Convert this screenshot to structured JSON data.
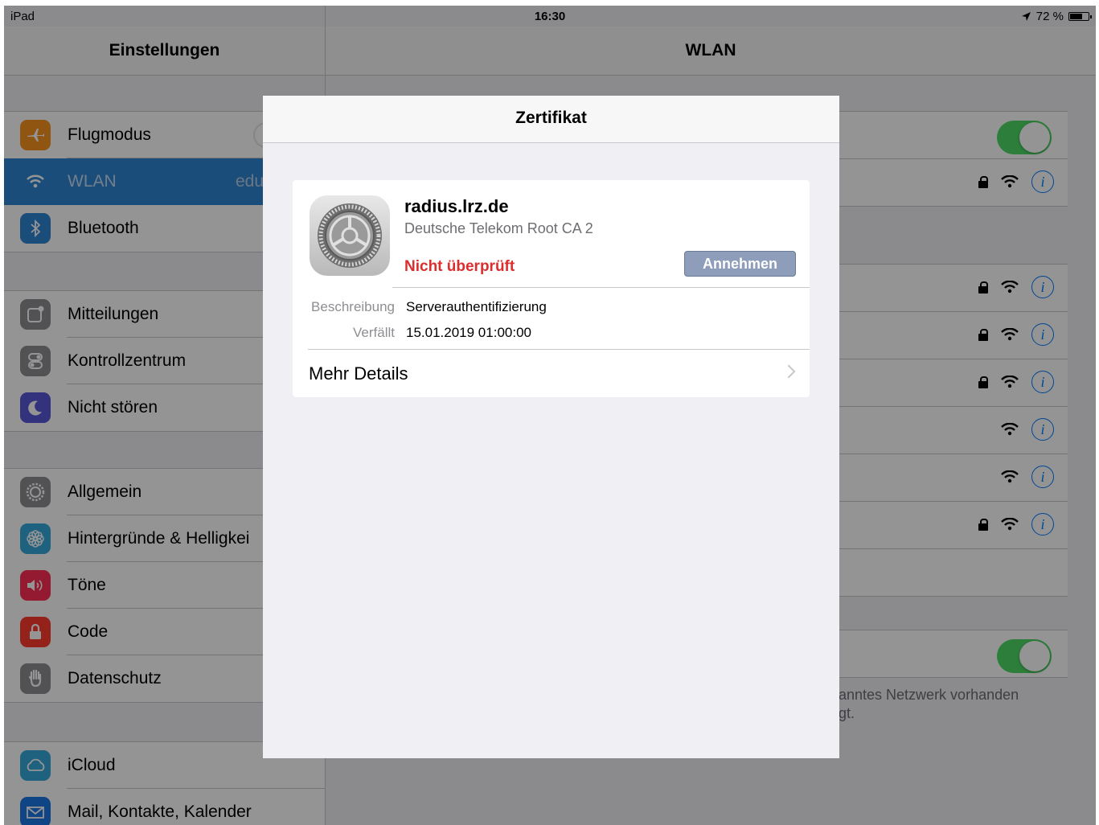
{
  "status_bar": {
    "device": "iPad",
    "time": "16:30",
    "battery": "72 %",
    "battery_level": 0.72
  },
  "left_panel": {
    "title": "Einstellungen",
    "groups": [
      [
        {
          "label": "Flugmodus",
          "icon": "airplane-icon",
          "color": "#f7931e"
        },
        {
          "label": "WLAN",
          "value": "edu",
          "icon": "wifi-icon",
          "color": "#2f86d4",
          "selected": true
        },
        {
          "label": "Bluetooth",
          "icon": "bluetooth-icon",
          "color": "#2f86d4"
        }
      ],
      [
        {
          "label": "Mitteilungen",
          "icon": "notifications-icon",
          "color": "#8e8e93"
        },
        {
          "label": "Kontrollzentrum",
          "icon": "control-center-icon",
          "color": "#8e8e93"
        },
        {
          "label": "Nicht stören",
          "icon": "moon-icon",
          "color": "#5856d6"
        }
      ],
      [
        {
          "label": "Allgemein",
          "icon": "gear-icon",
          "color": "#8e8e93"
        },
        {
          "label": "Hintergründe & Helligkei",
          "icon": "flower-icon",
          "color": "#34aadc"
        },
        {
          "label": "Töne",
          "icon": "speaker-icon",
          "color": "#ff2d55"
        },
        {
          "label": "Code",
          "icon": "lock-icon",
          "color": "#ff3b30"
        },
        {
          "label": "Datenschutz",
          "icon": "hand-icon",
          "color": "#8e8e93"
        }
      ],
      [
        {
          "label": "iCloud",
          "icon": "cloud-icon",
          "color": "#34aadc"
        },
        {
          "label": "Mail, Kontakte, Kalender",
          "icon": "mail-icon",
          "color": "#1d77e6"
        }
      ]
    ]
  },
  "right_panel": {
    "title": "WLAN",
    "footnote_line1": "anntes Netzwerk vorhanden",
    "footnote_line2": "gt."
  },
  "modal": {
    "title": "Zertifikat",
    "cert_name": "radius.lrz.de",
    "issuer": "Deutsche Telekom Root CA 2",
    "status": "Nicht überprüft",
    "accept_label": "Annehmen",
    "description_key": "Beschreibung",
    "description_value": "Serverauthentifizierung",
    "expires_key": "Verfällt",
    "expires_value": "15.01.2019 01:00:00",
    "more_details": "Mehr Details"
  }
}
